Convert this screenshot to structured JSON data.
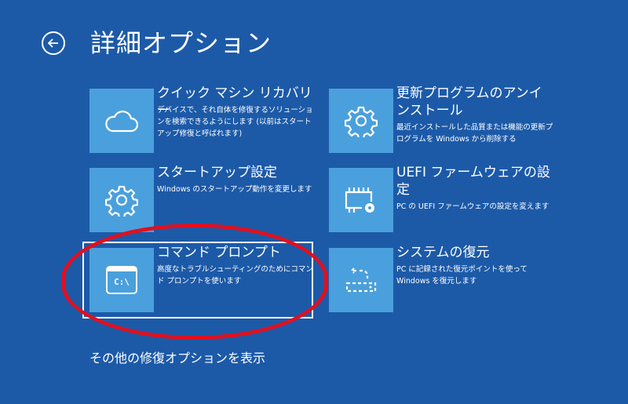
{
  "header": {
    "title": "詳細オプション"
  },
  "options": [
    {
      "title": "クイック マシン リカバリー",
      "desc": "デバイスで、それ自体を修復するソリューションを検索できるようにします (以前はスタートアップ修復と呼ばれます)",
      "icon": "cloud-icon"
    },
    {
      "title": "更新プログラムのアンインストール",
      "desc": "最近インストールした品質または機能の更新プログラムを Windows から削除する",
      "icon": "gear-icon"
    },
    {
      "title": "スタートアップ設定",
      "desc": "Windows のスタートアップ動作を変更します",
      "icon": "gear-icon"
    },
    {
      "title": "UEFI ファームウェアの設定",
      "desc": "PC の UEFI ファームウェアの設定を変えます",
      "icon": "firmware-chip-icon"
    },
    {
      "title": "コマンド プロンプト",
      "desc": "高度なトラブルシューティングのためにコマンド プロンプトを使います",
      "icon": "command-prompt-icon",
      "icon_text": "C:\\"
    },
    {
      "title": "システムの復元",
      "desc": "PC に記録された復元ポイントを使って Windows を復元します",
      "icon": "system-restore-icon"
    }
  ],
  "more_link": "その他の修復オプションを表示",
  "colors": {
    "background": "#1c5aa8",
    "tile": "#4aa0dc",
    "annotation": "#e01020"
  }
}
